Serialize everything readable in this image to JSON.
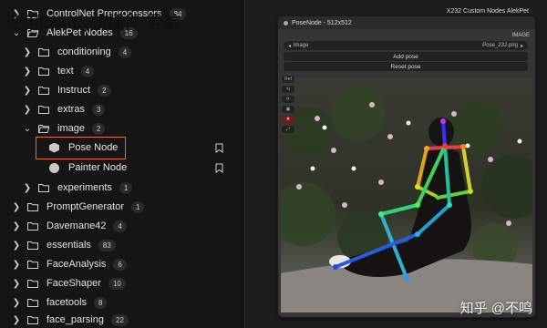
{
  "overlay_text": "使用ComfyUI插件-导航",
  "sidebar": {
    "rows": [
      {
        "label": "ControlNet Preprocessors",
        "count": "84",
        "level": 0,
        "expanded": false
      },
      {
        "label": "AlekPet Nodes",
        "count": "16",
        "level": 0,
        "expanded": true
      },
      {
        "label": "conditioning",
        "count": "4",
        "level": 1,
        "expanded": false
      },
      {
        "label": "text",
        "count": "4",
        "level": 1,
        "expanded": false
      },
      {
        "label": "Instruct",
        "count": "2",
        "level": 1,
        "expanded": false
      },
      {
        "label": "extras",
        "count": "3",
        "level": 1,
        "expanded": false
      },
      {
        "label": "image",
        "count": "2",
        "level": 1,
        "expanded": true
      },
      {
        "label": "experiments",
        "count": "1",
        "level": 1,
        "expanded": false
      },
      {
        "label": "PromptGenerator",
        "count": "1",
        "level": 0,
        "expanded": false
      },
      {
        "label": "Davemane42",
        "count": "4",
        "level": 0,
        "expanded": false
      },
      {
        "label": "essentials",
        "count": "83",
        "level": 0,
        "expanded": false
      },
      {
        "label": "FaceAnalysis",
        "count": "6",
        "level": 0,
        "expanded": false
      },
      {
        "label": "FaceShaper",
        "count": "10",
        "level": 0,
        "expanded": false
      },
      {
        "label": "facetools",
        "count": "8",
        "level": 0,
        "expanded": false
      },
      {
        "label": "face_parsing",
        "count": "22",
        "level": 0,
        "expanded": false
      }
    ],
    "leaves": [
      {
        "label": "Pose Node",
        "icon": "hexagon-node-icon",
        "selected": true
      },
      {
        "label": "Painter Node",
        "icon": "circle-node-icon",
        "selected": false
      }
    ]
  },
  "canvas": {
    "top_right_title": "X232 Custom Nodes AlekPet",
    "node": {
      "title": "PoseNode - 512x512",
      "output_label": "IMAGE",
      "combo_label": "image",
      "combo_value": "Pose_232.png",
      "buttons": [
        "Add pose",
        "Reset pose"
      ],
      "tools": [
        "Ref",
        "⟲",
        "⟳",
        "▣",
        "✖",
        "⤢"
      ]
    }
  },
  "watermark": "知乎 @不鸣",
  "colors": {
    "highlight_border": "#e0703a",
    "sidebar_bg": "#151515",
    "node_bg": "#353535"
  }
}
